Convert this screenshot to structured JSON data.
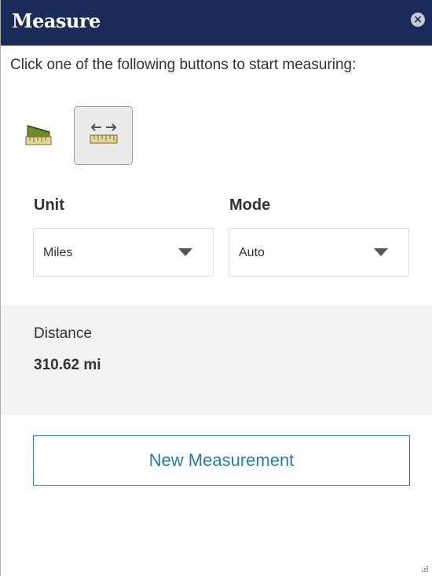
{
  "window": {
    "title": "Measure",
    "close_icon": "close-icon"
  },
  "instructions": "Click one of the following buttons to start measuring:",
  "tools": [
    {
      "name": "area",
      "icon": "area-ruler-icon",
      "selected": false
    },
    {
      "name": "distance",
      "icon": "distance-ruler-icon",
      "selected": true
    }
  ],
  "unit": {
    "label": "Unit",
    "value": "Miles"
  },
  "mode": {
    "label": "Mode",
    "value": "Auto"
  },
  "result": {
    "label": "Distance",
    "value": "310.62 mi"
  },
  "new_button_label": "New Measurement",
  "colors": {
    "titlebar": "#1b2b5a",
    "accent": "#2a7ab0",
    "result_bg": "#f2f2f2"
  }
}
